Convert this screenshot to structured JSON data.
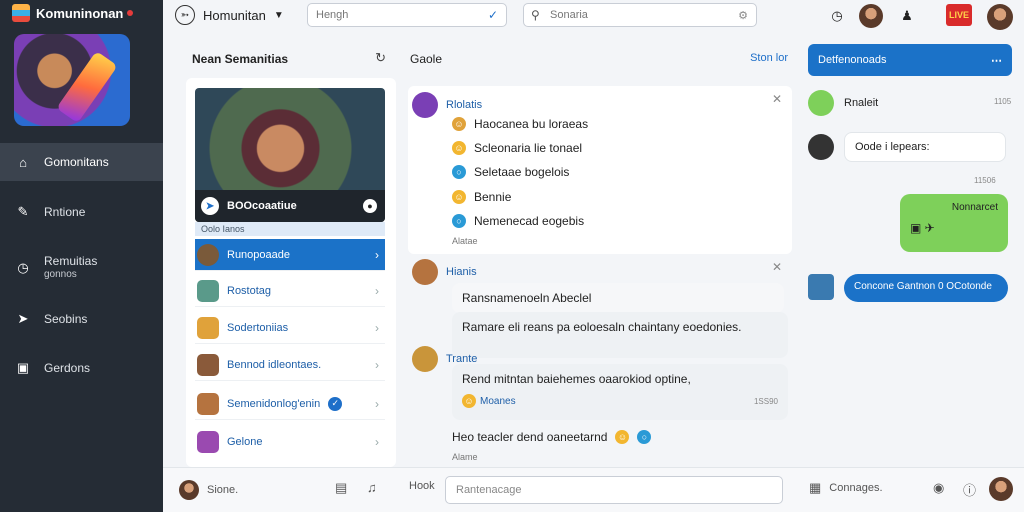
{
  "app": {
    "name": "Komuninonan"
  },
  "sidebar": {
    "items": [
      {
        "label": "Gomonitans",
        "icon": "home-icon",
        "active": true
      },
      {
        "label": "Rntione",
        "icon": "tool-icon"
      },
      {
        "label": "Remuitias",
        "sub": "gonnos",
        "icon": "clock-icon"
      },
      {
        "label": "Seobins",
        "icon": "rocket-icon"
      },
      {
        "label": "Gerdons",
        "icon": "archive-icon"
      }
    ]
  },
  "topbar": {
    "title": "Homunitan",
    "search1_placeholder": "Hengh",
    "search2_placeholder": "Sonaria",
    "badge_text": "LIVE"
  },
  "panel_left": {
    "title": "Nean Semanitias",
    "card_name": "BOOcoaatiue",
    "card_tag": "Oolo Ianos",
    "rows": [
      {
        "label": "Runopoaade",
        "active": true
      },
      {
        "label": "Rostotag"
      },
      {
        "label": "Sodertoniias"
      },
      {
        "label": "Bennod idleontaes."
      },
      {
        "label": "Semenidonlog'enin"
      },
      {
        "label": "Gelone"
      }
    ]
  },
  "chat": {
    "title": "Gaole",
    "link": "Ston lor",
    "group1": {
      "author": "Rlolatis",
      "lines": [
        "Haocanea bu loraeas",
        "Scleonaria lie tonael",
        "Seletaae bogelois",
        "Bennie",
        "Nemenecad eogebis"
      ],
      "footer": "Alatae"
    },
    "group2": {
      "author": "Hianis",
      "lines": [
        "Ransnamenoeln Abeclel",
        "Ramare eli reans pa eoloesaln chaintany eoedonies."
      ]
    },
    "group3": {
      "author": "Trante",
      "lines": [
        "Rend mitntan baiehemes oaarokiod optine,",
        "Moanes",
        "Heo teacler dend oaneetarnd"
      ],
      "time": "1SS90"
    },
    "trailing": "Alame"
  },
  "right_panel": {
    "header": "Detfenonoads",
    "items": [
      {
        "name": "Rnaleit",
        "time": "1105"
      },
      {
        "message": "Oode i lepears:",
        "time": "11506"
      }
    ],
    "green_message": "Nonnarcet",
    "blue_message": "Concone Gantnon 0 OCotonde"
  },
  "bottom": {
    "status": "Sione.",
    "home": "Hook",
    "input_placeholder": "Rantenacage",
    "right_label": "Connages."
  },
  "colors": {
    "accent": "#1b72c8",
    "sidebar": "#252c35",
    "green": "#7ed05a"
  }
}
